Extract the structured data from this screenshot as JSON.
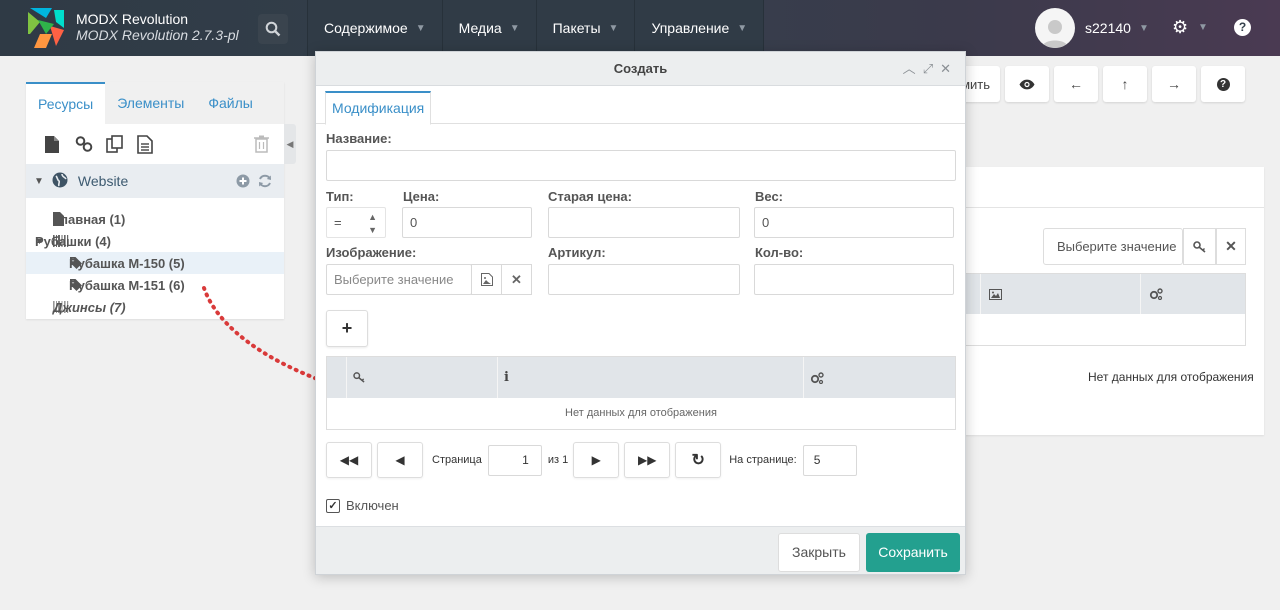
{
  "app": {
    "brand_title": "MODX Revolution",
    "brand_subtitle": "MODX Revolution 2.7.3-pl"
  },
  "topnav": {
    "items": [
      {
        "label": "Содержимое"
      },
      {
        "label": "Медиа"
      },
      {
        "label": "Пакеты"
      },
      {
        "label": "Управление"
      }
    ],
    "user_name": "s22140"
  },
  "left_panel": {
    "tabs": [
      {
        "label": "Ресурсы",
        "active": true
      },
      {
        "label": "Элементы"
      },
      {
        "label": "Файлы"
      }
    ],
    "context_label": "Website",
    "tree": [
      {
        "label": "Главная (1)"
      },
      {
        "label": "Рубашки (4)"
      },
      {
        "label": "Рубашка М-150 (5)"
      },
      {
        "label": "Рубашка М-151 (6)"
      },
      {
        "label": "Джинсы (7)"
      }
    ]
  },
  "right_panel": {
    "toolbar_partial_label": "мить",
    "select_placeholder": "Выберите значение",
    "empty_text": "Нет данных для отображения"
  },
  "dialog": {
    "title": "Создать",
    "tab_label": "Модификация",
    "fields": {
      "name_label": "Название:",
      "name_value": "",
      "type_label": "Тип:",
      "type_value": "=",
      "price_label": "Цена:",
      "price_value": "0",
      "old_price_label": "Старая цена:",
      "old_price_value": "",
      "weight_label": "Вес:",
      "weight_value": "0",
      "image_label": "Изображение:",
      "image_placeholder": "Выберите значение",
      "article_label": "Артикул:",
      "article_value": "",
      "qty_label": "Кол-во:",
      "qty_value": ""
    },
    "grid": {
      "empty_text": "Нет данных для отображения"
    },
    "pager": {
      "page_label": "Страница",
      "page_value": "1",
      "of_label": "из 1",
      "per_page_label": "На странице:",
      "per_page_value": "5"
    },
    "enabled_label": "Включен",
    "close_label": "Закрыть",
    "save_label": "Сохранить"
  },
  "colors": {
    "accent": "#3a8fc8",
    "save_button": "#23a08f",
    "annotation_arrow": "#d93a3a"
  }
}
